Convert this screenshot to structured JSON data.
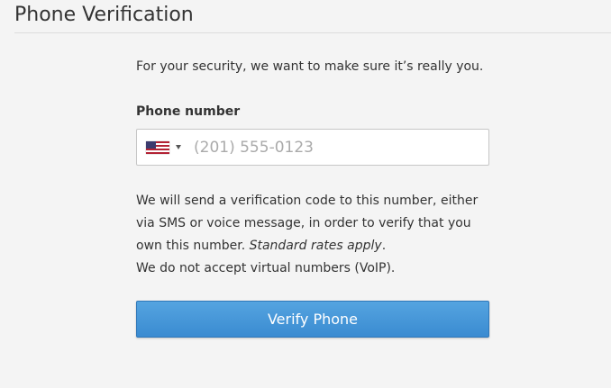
{
  "page": {
    "title": "Phone Verification"
  },
  "intro": {
    "text": "For your security, we want to make sure it’s really you."
  },
  "phone": {
    "label": "Phone number",
    "country_icon": "us-flag-icon",
    "placeholder": "(201) 555-0123",
    "value": ""
  },
  "info": {
    "line1": "We will send a verification code to this number, either via SMS or voice message, in order to verify that you own this number. ",
    "rates": "Standard rates apply",
    "period": ".",
    "voip": "We do not accept virtual numbers (VoIP)."
  },
  "verify_button": {
    "label": "Verify Phone"
  },
  "colors": {
    "background": "#f4f4f4",
    "button": "#4a9bdc",
    "button_text": "#ffffff"
  }
}
